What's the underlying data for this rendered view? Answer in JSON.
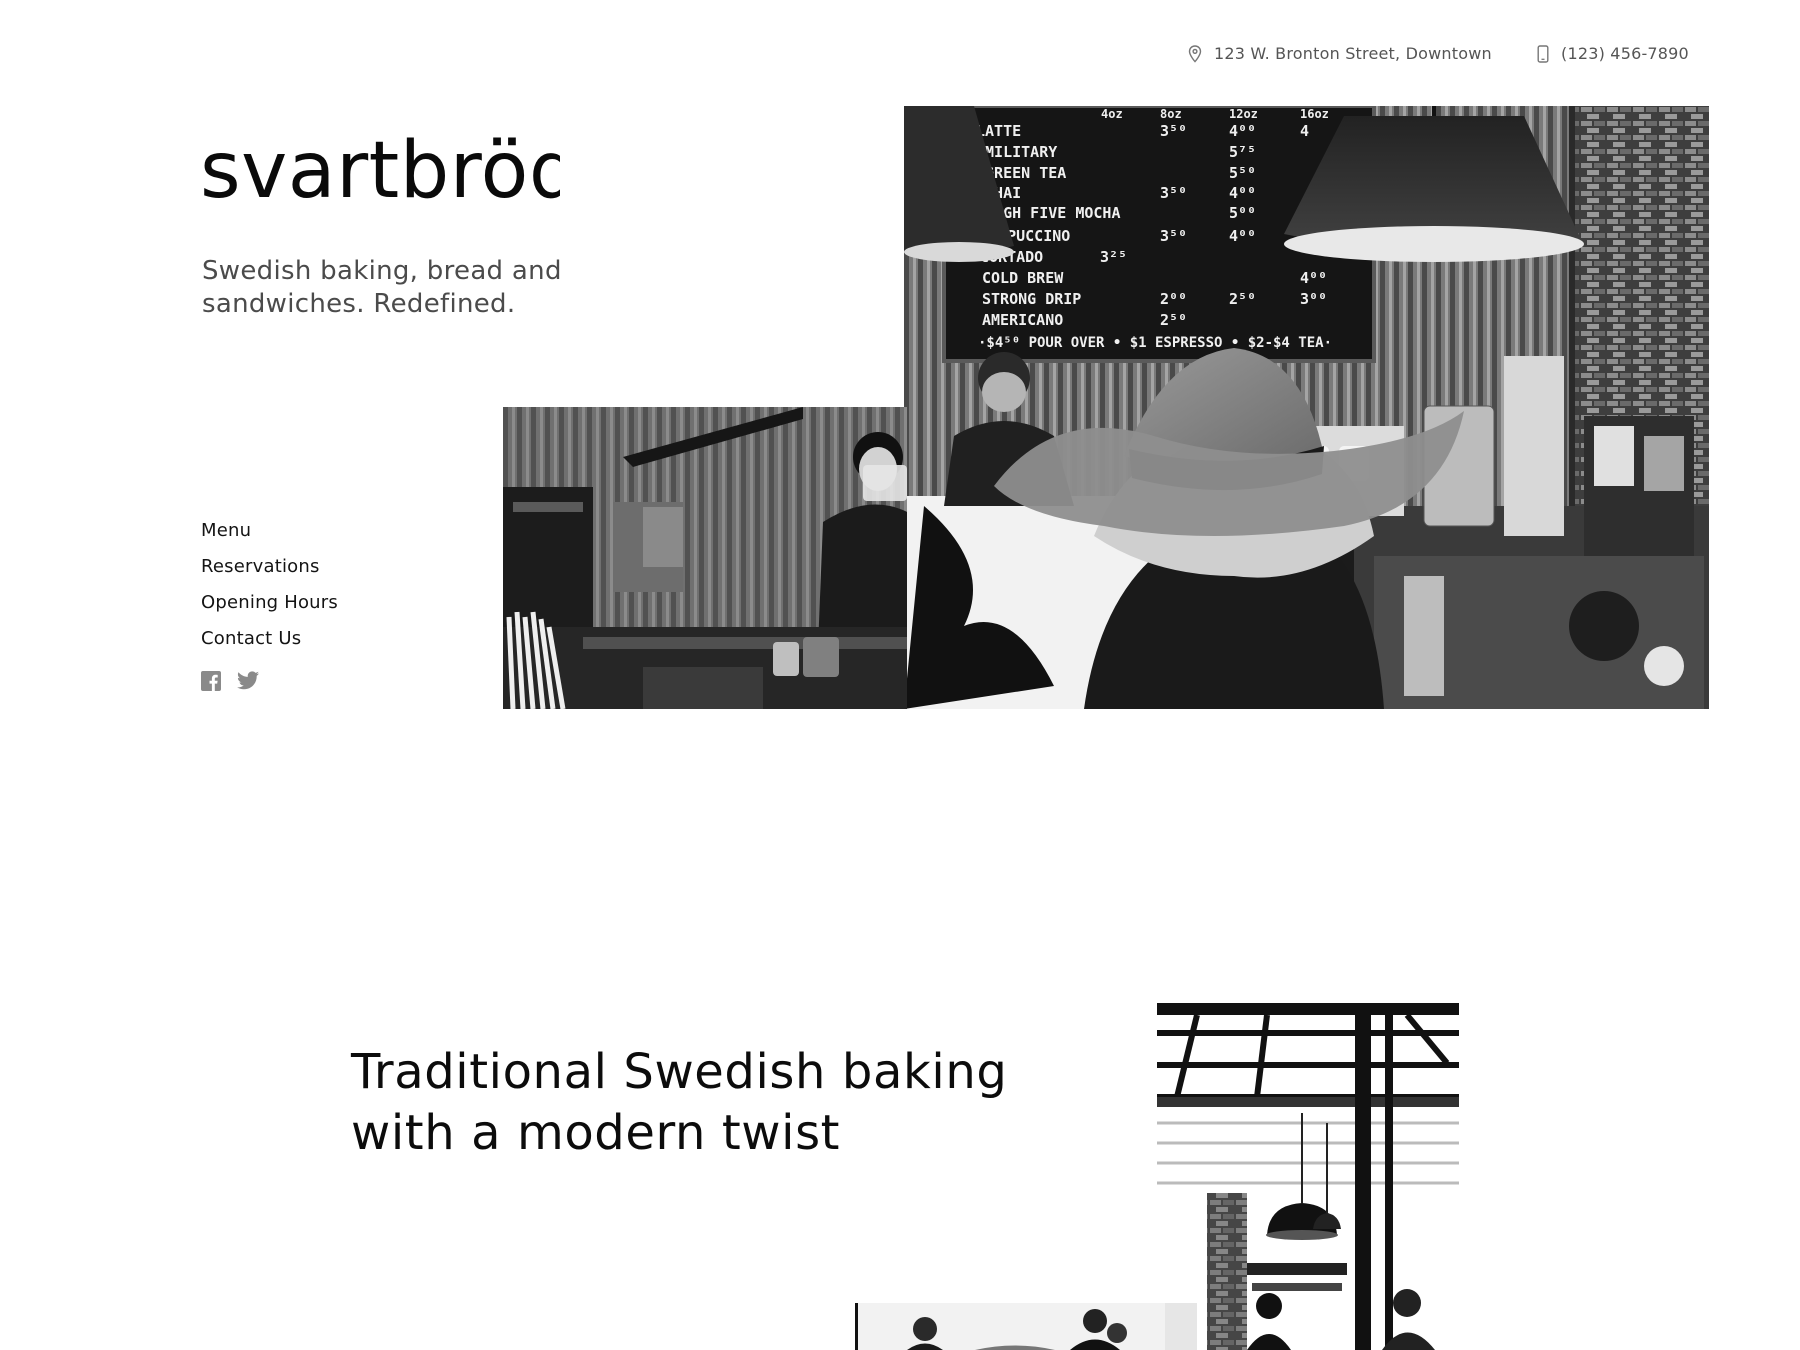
{
  "header": {
    "address": "123 W. Bronton Street, Downtown",
    "phone": "(123) 456-7890",
    "address_icon": "map-pin-icon",
    "phone_icon": "mobile-phone-icon"
  },
  "brand": {
    "logo_text": "svartbröd",
    "tagline": "Swedish baking, bread and sandwiches. Redefined."
  },
  "nav": {
    "items": [
      {
        "label": "Menu"
      },
      {
        "label": "Reservations"
      },
      {
        "label": "Opening Hours"
      },
      {
        "label": "Contact Us"
      }
    ],
    "socials": [
      {
        "icon": "facebook-icon"
      },
      {
        "icon": "twitter-icon"
      }
    ]
  },
  "hero": {
    "menu_board": {
      "header": [
        "4oz",
        "8oz",
        "12oz",
        "16oz"
      ],
      "rows": [
        {
          "item": "LATTE",
          "prices": [
            "",
            "3⁵⁰",
            "4⁰⁰",
            "4"
          ]
        },
        {
          "item": "→MILITARY",
          "prices": [
            "",
            "",
            "5⁷⁵",
            ""
          ]
        },
        {
          "item": "→GREEN TEA",
          "prices": [
            "",
            "",
            "5⁵⁰",
            ""
          ]
        },
        {
          "item": "→CHAI",
          "prices": [
            "",
            "3⁵⁰",
            "4⁰⁰",
            ""
          ]
        },
        {
          "item": "→HIGH FIVE MOCHA",
          "prices": [
            "",
            "",
            "5⁰⁰",
            ""
          ]
        },
        {
          "item": "CAPPUCCINO",
          "prices": [
            "",
            "3⁵⁰",
            "4⁰⁰",
            ""
          ]
        },
        {
          "item": "CORTADO",
          "prices": [
            "3²⁵",
            "",
            "",
            ""
          ]
        },
        {
          "item": "COLD BREW",
          "prices": [
            "",
            "",
            "",
            "4⁰⁰"
          ]
        },
        {
          "item": "STRONG DRIP",
          "prices": [
            "",
            "2⁰⁰",
            "2⁵⁰",
            "3⁰⁰"
          ]
        },
        {
          "item": "AMERICANO",
          "prices": [
            "",
            "2⁵⁰",
            "",
            ""
          ]
        }
      ],
      "footer": "·$4⁵⁰ POUR OVER • $1 ESPRESSO • $2-$4 TEA·"
    }
  },
  "intro": {
    "heading": "Traditional Swedish baking with a modern twist"
  },
  "colors": {
    "text_primary": "#111111",
    "text_secondary": "#4b4b4b",
    "icon_gray": "#8a8a8a",
    "background": "#ffffff"
  }
}
